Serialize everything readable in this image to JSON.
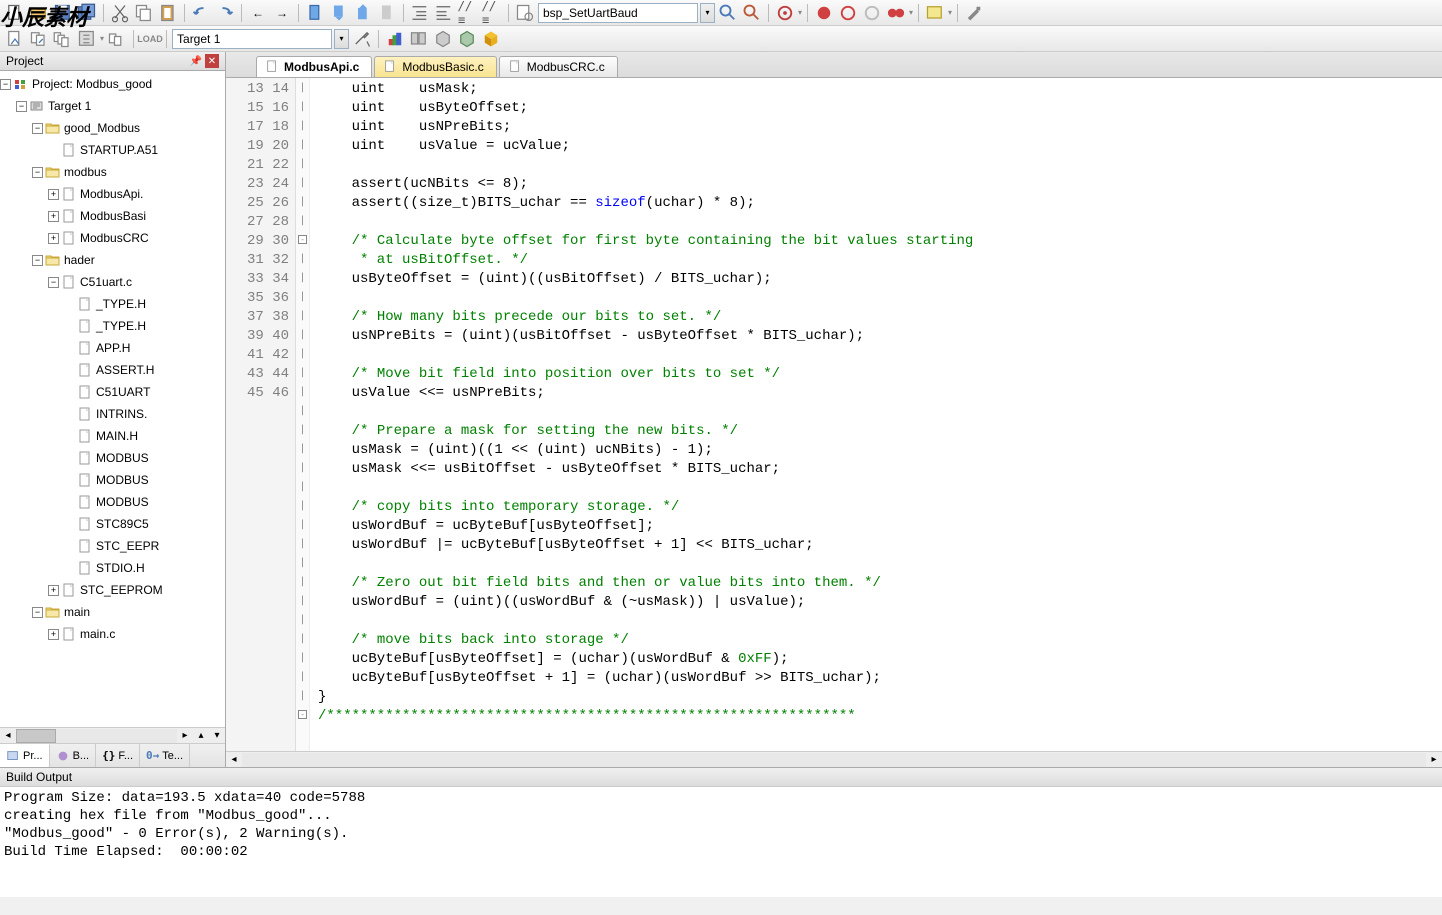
{
  "watermark": "小辰素材",
  "toolbar": {
    "combo_top": "bsp_SetUartBaud",
    "target": "Target 1"
  },
  "project_panel": {
    "title": "Project",
    "tree": {
      "root": "Project: Modbus_good",
      "target": "Target 1",
      "group1": "good_Modbus",
      "g1_files": [
        "STARTUP.A51"
      ],
      "group2": "modbus",
      "g2_files": [
        "ModbusApi.",
        "ModbusBasi",
        "ModbusCRC"
      ],
      "group3": "hader",
      "g3_parent": "C51uart.c",
      "g3_files": [
        "_TYPE.H",
        "_TYPE.H",
        "APP.H",
        "ASSERT.H",
        "C51UART",
        "INTRINS.",
        "MAIN.H",
        "MODBUS",
        "MODBUS",
        "MODBUS",
        "STC89C5",
        "STC_EEPR",
        "STDIO.H"
      ],
      "g3_extra": "STC_EEPROM",
      "group4": "main",
      "g4_files": [
        "main.c"
      ]
    },
    "tabs": [
      "Pr...",
      "B...",
      "F...",
      "Te..."
    ],
    "tab_prefixes": [
      "",
      "{} ",
      "",
      ""
    ]
  },
  "editor": {
    "tabs": [
      {
        "name": "ModbusApi.c",
        "active": true,
        "modified": false
      },
      {
        "name": "ModbusBasic.c",
        "active": false,
        "modified": true
      },
      {
        "name": "ModbusCRC.c",
        "active": false,
        "modified": false
      }
    ],
    "first_line": 13,
    "code_lines": [
      {
        "n": 13,
        "t": "    uint    usMask;",
        "f": ""
      },
      {
        "n": 14,
        "t": "    uint    usByteOffset;",
        "f": ""
      },
      {
        "n": 15,
        "t": "    uint    usNPreBits;",
        "f": ""
      },
      {
        "n": 16,
        "t": "    uint    usValue = ucValue;",
        "f": ""
      },
      {
        "n": 17,
        "t": "",
        "f": ""
      },
      {
        "n": 18,
        "t": "    assert(ucNBits <= 8);",
        "f": ""
      },
      {
        "n": 19,
        "t": "    assert((size_t)BITS_uchar == <kw>sizeof</kw>(uchar) * 8);",
        "f": ""
      },
      {
        "n": 20,
        "t": "",
        "f": ""
      },
      {
        "n": 21,
        "t": "    <cm>/* Calculate byte offset for first byte containing the bit values starting</cm>",
        "f": "-"
      },
      {
        "n": 22,
        "t": "<cm>     * at usBitOffset. */</cm>",
        "f": ""
      },
      {
        "n": 23,
        "t": "    usByteOffset = (uint)((usBitOffset) / BITS_uchar);",
        "f": ""
      },
      {
        "n": 24,
        "t": "",
        "f": ""
      },
      {
        "n": 25,
        "t": "    <cm>/* How many bits precede our bits to set. */</cm>",
        "f": ""
      },
      {
        "n": 26,
        "t": "    usNPreBits = (uint)(usBitOffset - usByteOffset * BITS_uchar);",
        "f": ""
      },
      {
        "n": 27,
        "t": "",
        "f": ""
      },
      {
        "n": 28,
        "t": "    <cm>/* Move bit field into position over bits to set */</cm>",
        "f": ""
      },
      {
        "n": 29,
        "t": "    usValue <<= usNPreBits;",
        "f": ""
      },
      {
        "n": 30,
        "t": "",
        "f": ""
      },
      {
        "n": 31,
        "t": "    <cm>/* Prepare a mask for setting the new bits. */</cm>",
        "f": ""
      },
      {
        "n": 32,
        "t": "    usMask = (uint)((1 << (uint) ucNBits) - 1);",
        "f": ""
      },
      {
        "n": 33,
        "t": "    usMask <<= usBitOffset - usByteOffset * BITS_uchar;",
        "f": ""
      },
      {
        "n": 34,
        "t": "",
        "f": ""
      },
      {
        "n": 35,
        "t": "    <cm>/* copy bits into temporary storage. */</cm>",
        "f": ""
      },
      {
        "n": 36,
        "t": "    usWordBuf = ucByteBuf[usByteOffset];",
        "f": ""
      },
      {
        "n": 37,
        "t": "    usWordBuf |= ucByteBuf[usByteOffset + 1] << BITS_uchar;",
        "f": ""
      },
      {
        "n": 38,
        "t": "",
        "f": ""
      },
      {
        "n": 39,
        "t": "    <cm>/* Zero out bit field bits and then or value bits into them. */</cm>",
        "f": ""
      },
      {
        "n": 40,
        "t": "    usWordBuf = (uint)((usWordBuf & (~usMask)) | usValue);",
        "f": ""
      },
      {
        "n": 41,
        "t": "",
        "f": ""
      },
      {
        "n": 42,
        "t": "    <cm>/* move bits back into storage */</cm>",
        "f": ""
      },
      {
        "n": 43,
        "t": "    ucByteBuf[usByteOffset] = (uchar)(usWordBuf & <num>0xFF</num>);",
        "f": ""
      },
      {
        "n": 44,
        "t": "    ucByteBuf[usByteOffset + 1] = (uchar)(usWordBuf >> BITS_uchar);",
        "f": ""
      },
      {
        "n": 45,
        "t": "}",
        "f": ""
      },
      {
        "n": 46,
        "t": "<cm>/***************************************************************</cm>",
        "f": "-"
      }
    ]
  },
  "build": {
    "title": "Build Output",
    "lines": [
      "Program Size: data=193.5 xdata=40 code=5788",
      "creating hex file from \"Modbus_good\"...",
      "\"Modbus_good\" - 0 Error(s), 2 Warning(s).",
      "Build Time Elapsed:  00:00:02"
    ]
  }
}
